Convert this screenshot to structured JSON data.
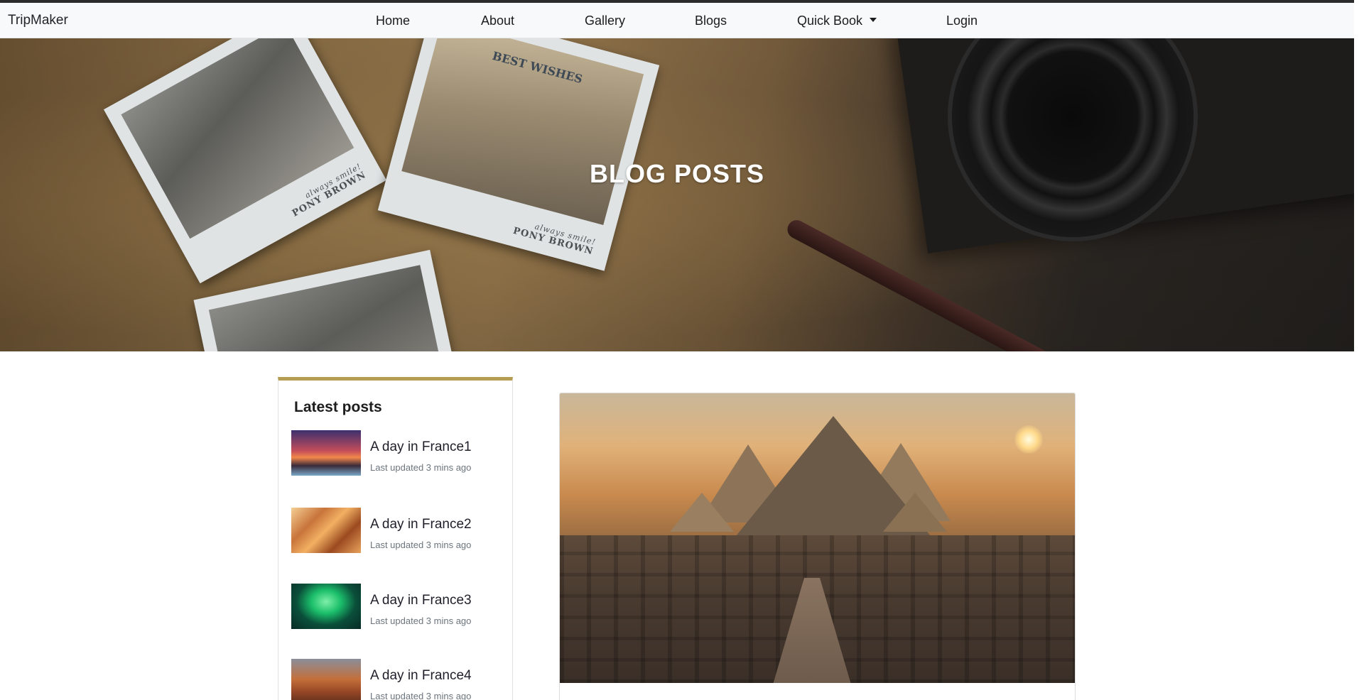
{
  "navbar": {
    "brand": "TripMaker",
    "items": [
      {
        "label": "Home"
      },
      {
        "label": "About"
      },
      {
        "label": "Gallery"
      },
      {
        "label": "Blogs"
      },
      {
        "label": "Quick Book",
        "dropdown": true
      },
      {
        "label": "Login"
      }
    ]
  },
  "hero": {
    "title": "BLOG POSTS",
    "polaroid_captions": [
      {
        "top": "always smile!",
        "bottom": "PONY BROWN"
      },
      {
        "header": "BEST WISHES",
        "top": "always smile!",
        "bottom": "PONY BROWN"
      }
    ]
  },
  "sidebar": {
    "title": "Latest posts",
    "posts": [
      {
        "title": "A day in France1",
        "meta": "Last updated 3 mins ago"
      },
      {
        "title": "A day in France2",
        "meta": "Last updated 3 mins ago"
      },
      {
        "title": "A day in France3",
        "meta": "Last updated 3 mins ago"
      },
      {
        "title": "A day in France4",
        "meta": "Last updated 3 mins ago"
      }
    ]
  },
  "colors": {
    "accent": "#b59d52",
    "navbar_bg": "#f8f9fa",
    "muted_text": "#6c757d"
  }
}
